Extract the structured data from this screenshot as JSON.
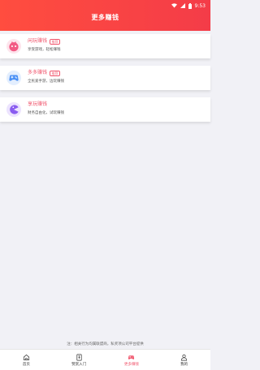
{
  "status": {
    "time": "9:53"
  },
  "header": {
    "title": "更多赚钱"
  },
  "cards": [
    {
      "title": "闲玩赚钱",
      "badge": "推荐",
      "subtitle": "享受游戏，轻松赚钱",
      "icon": "xianwan-icon",
      "icon_color": "#f25a84"
    },
    {
      "title": "多多赚钱",
      "badge": "推荐",
      "subtitle": "全民爱手游，边玩赚钱",
      "icon": "gamepad-icon",
      "icon_color": "#4a90f5"
    },
    {
      "title": "享玩赚钱",
      "badge": "",
      "subtitle": "财务自由化，试玩赚钱",
      "icon": "pacman-icon",
      "icon_color": "#8a5cf0"
    }
  ],
  "notice": "注：相关行为均属联盟商，私奖项公司平台提供",
  "tabs": [
    {
      "label": "首页",
      "icon": "home-icon"
    },
    {
      "label": "赞赏入门",
      "icon": "document-icon"
    },
    {
      "label": "更多赚钱",
      "icon": "gamepad-icon"
    },
    {
      "label": "我的",
      "icon": "user-icon"
    }
  ],
  "colors": {
    "accent": "#f0576e",
    "header": "#f8433f"
  }
}
